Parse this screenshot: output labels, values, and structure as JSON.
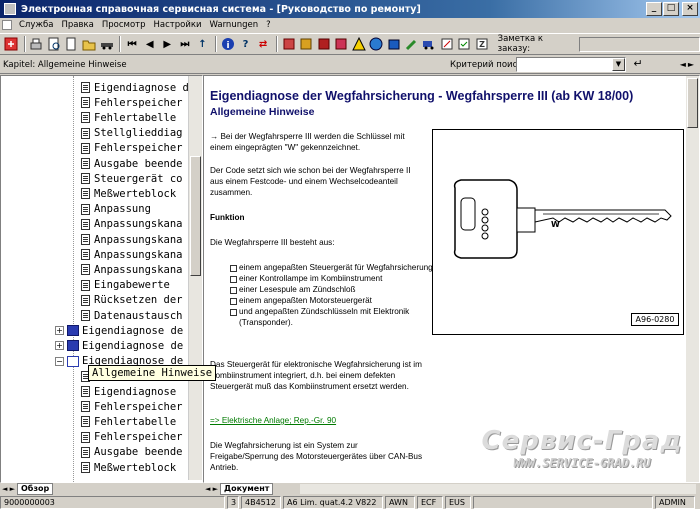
{
  "window": {
    "title": "Электронная справочная сервисная система - [Руководство по ремонту]",
    "buttons": {
      "minimize": "_",
      "maximize": "□",
      "close": "×"
    }
  },
  "menu": {
    "items": [
      "Служба",
      "Правка",
      "Просмотр",
      "Настройки",
      "Warnungen",
      "?"
    ]
  },
  "toolbar": {
    "icons": [
      "exit-icon",
      "print-icon",
      "print-preview-icon",
      "new-doc-icon",
      "open-icon",
      "car-icon",
      "first-icon",
      "prev-icon",
      "next-icon",
      "last-icon",
      "up-level-icon",
      "info-icon",
      "help-icon",
      "sync-icon",
      "book-1-icon",
      "book-2-icon",
      "book-3-icon",
      "book-4-icon",
      "warning-icon",
      "globe-icon",
      "tool-icon",
      "wrench-icon",
      "truck-icon",
      "edit-icon",
      "check-icon",
      "filter-icon"
    ],
    "order_label": "Заметка к заказу:",
    "order_value": ""
  },
  "chapter": {
    "label": "Kapitel: Allgemeine Hinweise",
    "search_label": "Критерий поиска:",
    "search_value": "",
    "search_button": "↵",
    "arrows": "◄►"
  },
  "tree": {
    "items": [
      {
        "label": "Eigendiagnose d",
        "kind": "doc"
      },
      {
        "label": "Fehlerspeicher",
        "kind": "doc"
      },
      {
        "label": "Fehlertabelle",
        "kind": "doc"
      },
      {
        "label": "Stellglieddiag",
        "kind": "doc"
      },
      {
        "label": "Fehlerspeicher",
        "kind": "doc"
      },
      {
        "label": "Ausgabe beende",
        "kind": "doc"
      },
      {
        "label": "Steuergerät co",
        "kind": "doc"
      },
      {
        "label": "Meßwerteblock",
        "kind": "doc"
      },
      {
        "label": "Anpassung",
        "kind": "doc"
      },
      {
        "label": "Anpassungskana",
        "kind": "doc"
      },
      {
        "label": "Anpassungskana",
        "kind": "doc"
      },
      {
        "label": "Anpassungskana",
        "kind": "doc"
      },
      {
        "label": "Anpassungskana",
        "kind": "doc"
      },
      {
        "label": "Eingabewerte",
        "kind": "doc"
      },
      {
        "label": "Rücksetzen der",
        "kind": "doc"
      },
      {
        "label": "Datenaustausch",
        "kind": "doc"
      },
      {
        "label": "Eigendiagnose de",
        "kind": "book",
        "expander": "+"
      },
      {
        "label": "Eigendiagnose de",
        "kind": "book",
        "expander": "+"
      },
      {
        "label": "Eigendiagnose de",
        "kind": "book-open",
        "expander": "−"
      },
      {
        "label": "Allgemeine Hinweise",
        "kind": "doc"
      },
      {
        "label": "Eigendiagnose",
        "kind": "doc"
      },
      {
        "label": "Fehlerspeicher",
        "kind": "doc"
      },
      {
        "label": "Fehlertabelle",
        "kind": "doc"
      },
      {
        "label": "Fehlerspeicher",
        "kind": "doc"
      },
      {
        "label": "Ausgabe beende",
        "kind": "doc"
      },
      {
        "label": "Meßwerteblock",
        "kind": "doc"
      }
    ],
    "tooltip": "Allgemeine Hinweise",
    "tab_label": "Обзор",
    "tab_arrows": "◄ ►"
  },
  "document": {
    "title": "Eigendiagnose der Wegfahrsicherung - Wegfahrsperre III (ab KW 18/00)",
    "subtitle": "Allgemeine Hinweise",
    "para1": "→ Bei der Wegfahrsperre III werden die Schlüssel mit einem eingeprägten \"W\" gekennzeichnet.",
    "para2": "Der Code setzt sich wie schon bei der Wegfahrsperre II aus einem Festcode- und einem Wechselcodeanteil zusammen.",
    "heading": "Funktion",
    "para3": "Die Wegfahrsperre III besteht aus:",
    "bullets": [
      "einem angepaßten Steuergerät für Wegfahrsicherung",
      "einer Kontrollampe im Kombiinstrument",
      "einer Lesespule am Zündschloß",
      "einem angepaßten Motorsteuergerät",
      "und angepaßten Zündschlüsseln mit Elektronik (Transponder)."
    ],
    "para4": "Das Steuergerät für elektronische Wegfahrsicherung ist im Kombiinstrument integriert, d.h. bei einem defekten Steuergerät muß das Kombiinstrument ersetzt werden.",
    "link": "=> Elektrische Anlage; Rep.-Gr. 90",
    "para5": "Die Wegfahrsicherung ist ein System zur Freigabe/Sperrung des Motorsteuergerätes über CAN-Bus Antrieb.",
    "figure_code": "A96-0280",
    "key_letter": "W",
    "tab_label": "Документ",
    "tab_arrows": "◄ ►"
  },
  "watermark": {
    "title": "Сервис-Град",
    "url": "WWW.SERVICE-GRAD.RU"
  },
  "status": {
    "cells": [
      "9000000003",
      "3",
      "4B4512",
      "A6 Lim. quat.4.2 V822",
      "AWN",
      "ECF",
      "EUS",
      "",
      "ADMIN"
    ]
  }
}
